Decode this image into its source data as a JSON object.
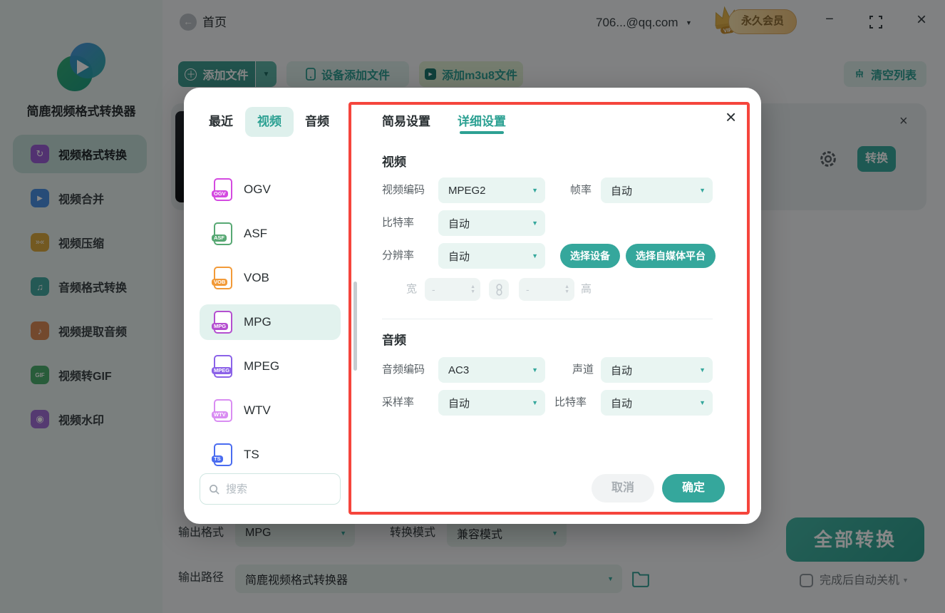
{
  "titlebar": {
    "home": "首页",
    "account": "706...@qq.com",
    "vip_label": "VIP",
    "vip_text": "永久会员"
  },
  "sidebar": {
    "app_name": "简鹿视频格式转换器",
    "items": [
      {
        "label": "视频格式转换",
        "icon": "video-convert-icon",
        "glyph": "↻",
        "color": "#9b5fd6"
      },
      {
        "label": "视频合并",
        "icon": "video-merge-icon",
        "glyph": "▶",
        "color": "#4a90e2"
      },
      {
        "label": "视频压缩",
        "icon": "video-compress-icon",
        "glyph": "»«",
        "color": "#d9a93f"
      },
      {
        "label": "音频格式转换",
        "icon": "audio-convert-icon",
        "glyph": "♫",
        "color": "#45a8a0"
      },
      {
        "label": "视频提取音频",
        "icon": "extract-audio-icon",
        "glyph": "♪",
        "color": "#d98a56"
      },
      {
        "label": "视频转GIF",
        "icon": "video-to-gif-icon",
        "glyph": "GIF",
        "color": "#4caf6e"
      },
      {
        "label": "视频水印",
        "icon": "watermark-icon",
        "glyph": "◉",
        "color": "#a06ed6"
      }
    ]
  },
  "toolbar": {
    "add_file": "添加文件",
    "device_add": "设备添加文件",
    "add_m3u8": "添加m3u8文件",
    "clear_list": "清空列表"
  },
  "file_row": {
    "convert": "转换"
  },
  "format_picker": {
    "tabs": [
      {
        "label": "最近"
      },
      {
        "label": "视频"
      },
      {
        "label": "音频"
      }
    ],
    "formats": [
      {
        "name": "OGV",
        "color": "#d44ae0"
      },
      {
        "name": "ASF",
        "color": "#57a873"
      },
      {
        "name": "VOB",
        "color": "#f29a38"
      },
      {
        "name": "MPG",
        "color": "#b44fd0"
      },
      {
        "name": "MPEG",
        "color": "#8b62e8"
      },
      {
        "name": "WTV",
        "color": "#d98df2"
      },
      {
        "name": "TS",
        "color": "#4a6cf0"
      }
    ],
    "search_placeholder": "搜索"
  },
  "settings": {
    "tab_simple": "简易设置",
    "tab_detailed": "详细设置",
    "video": {
      "heading": "视频",
      "codec_label": "视频编码",
      "codec_value": "MPEG2",
      "framerate_label": "帧率",
      "framerate_value": "自动",
      "bitrate_label": "比特率",
      "bitrate_value": "自动",
      "resolution_label": "分辨率",
      "resolution_value": "自动",
      "select_device": "选择设备",
      "select_platform": "选择自媒体平台",
      "width_label": "宽",
      "width_value": "-",
      "height_label": "高",
      "height_value": "-"
    },
    "audio": {
      "heading": "音频",
      "codec_label": "音频编码",
      "codec_value": "AC3",
      "channel_label": "声道",
      "channel_value": "自动",
      "samplerate_label": "采样率",
      "samplerate_value": "自动",
      "bitrate_label": "比特率",
      "bitrate_value": "自动"
    },
    "cancel": "取消",
    "confirm": "确定"
  },
  "footer": {
    "output_format_label": "输出格式",
    "output_format_value": "MPG",
    "convert_mode_label": "转换模式",
    "convert_mode_value": "兼容模式",
    "output_path_label": "输出路径",
    "output_path_value": "简鹿视频格式转换器",
    "convert_all": "全部转换",
    "auto_shutdown": "完成后自动关机"
  },
  "colors": {
    "primary": "#3aa99e",
    "annotation": "#f5453c"
  }
}
